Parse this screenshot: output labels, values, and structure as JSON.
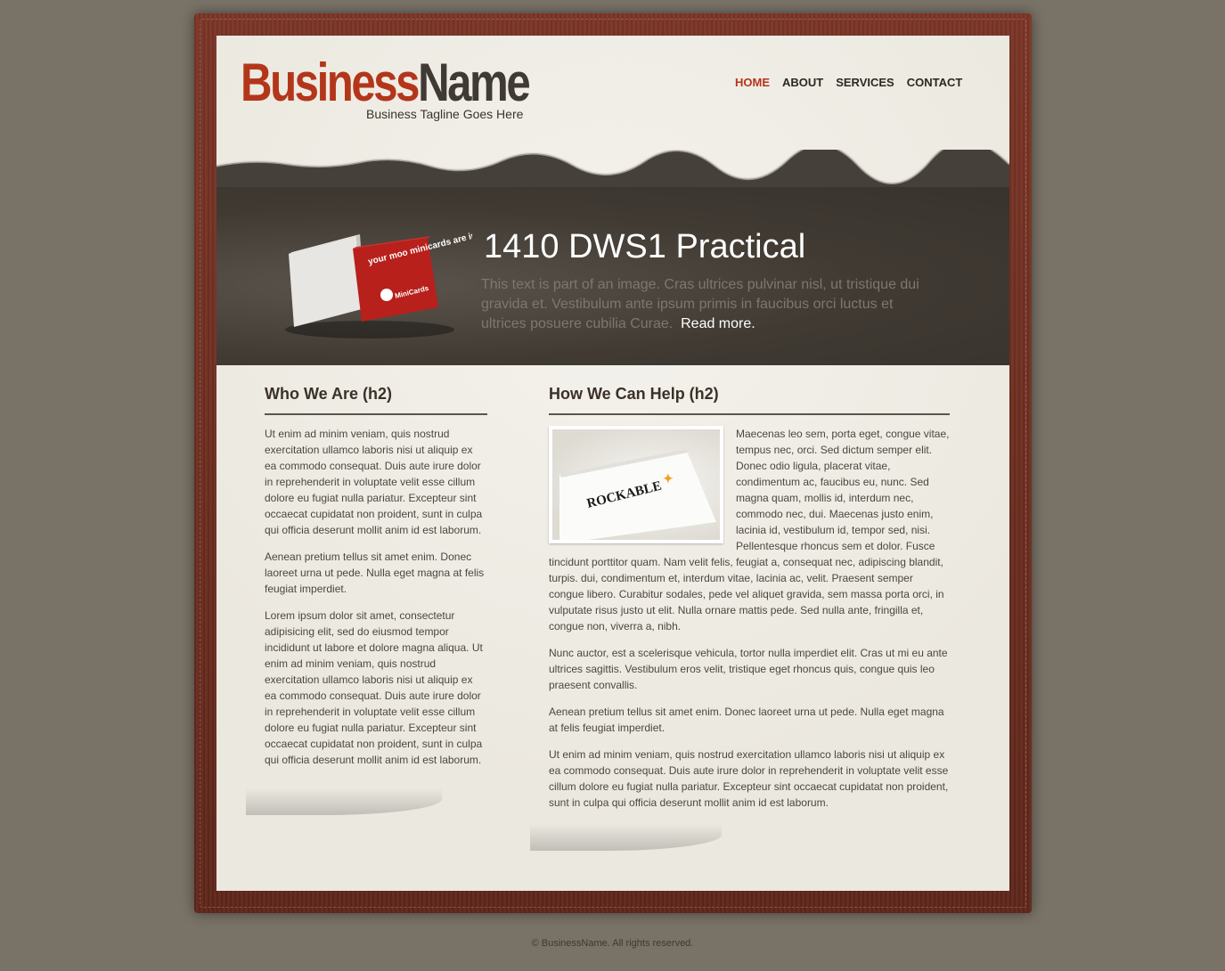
{
  "header": {
    "logo_part1": "Business",
    "logo_part2": "Name",
    "tagline": "Business Tagline Goes Here"
  },
  "nav": {
    "items": [
      "HOME",
      "ABOUT",
      "SERVICES",
      "CONTACT"
    ],
    "active": "HOME"
  },
  "hero": {
    "title": "1410 DWS1 Practical",
    "text": "This text is part of an image. Cras ultrices pulvinar nisl, ut tristique dui gravida et. Vestibulum ante ipsum primis in faucibus orci luctus et ultrices posuere cubilia Curae.",
    "read_more": "Read more.",
    "box_text": "your moo minicards are inside",
    "box_brand": "MiniCards"
  },
  "left_column": {
    "heading": "Who We Are (h2)",
    "paragraphs": [
      "Ut enim ad minim veniam, quis nostrud exercitation ullamco laboris nisi ut aliquip ex ea commodo consequat. Duis aute irure dolor in reprehenderit in voluptate velit esse cillum dolore eu fugiat nulla pariatur. Excepteur sint occaecat cupidatat non proident, sunt in culpa qui officia deserunt mollit anim id est laborum.",
      "Aenean pretium tellus sit amet enim. Donec laoreet urna ut pede. Nulla eget magna at felis feugiat imperdiet.",
      "Lorem ipsum dolor sit amet, consectetur adipisicing elit, sed do eiusmod tempor incididunt ut labore et dolore magna aliqua. Ut enim ad minim veniam, quis nostrud exercitation ullamco laboris nisi ut aliquip ex ea commodo consequat. Duis aute irure dolor in reprehenderit in voluptate velit esse cillum dolore eu fugiat nulla pariatur. Excepteur sint occaecat cupidatat non proident, sunt in culpa qui officia deserunt mollit anim id est laborum."
    ]
  },
  "right_column": {
    "heading": "How We Can Help (h2)",
    "image_logo": "ROCKABLE",
    "paragraphs": [
      "Maecenas leo sem, porta eget, congue vitae, tempus nec, orci. Sed dictum semper elit. Donec odio ligula, placerat vitae, condimentum ac, faucibus eu, nunc. Sed magna quam, mollis id, interdum nec, commodo nec, dui. Maecenas justo enim, lacinia id, vestibulum id, tempor sed, nisi. Pellentesque rhoncus sem et dolor. Fusce tincidunt porttitor quam. Nam velit felis, feugiat a, consequat nec, adipiscing blandit, turpis. dui, condimentum et, interdum vitae, lacinia ac, velit. Praesent semper congue libero. Curabitur sodales, pede vel aliquet gravida, sem massa porta orci, in vulputate risus justo ut elit. Nulla ornare mattis pede. Sed nulla ante, fringilla et, congue non, viverra a, nibh.",
      "Nunc auctor, est a scelerisque vehicula, tortor nulla imperdiet elit. Cras ut mi eu ante ultrices sagittis. Vestibulum eros velit, tristique eget rhoncus quis, congue quis leo praesent convallis.",
      "Aenean pretium tellus sit amet enim. Donec laoreet urna ut pede. Nulla eget magna at felis feugiat imperdiet.",
      "Ut enim ad minim veniam, quis nostrud exercitation ullamco laboris nisi ut aliquip ex ea commodo consequat. Duis aute irure dolor in reprehenderit in voluptate velit esse cillum dolore eu fugiat nulla pariatur. Excepteur sint occaecat cupidatat non proident, sunt in culpa qui officia deserunt mollit anim id est laborum."
    ]
  },
  "footer": {
    "copyright": "© BusinessName. All rights reserved."
  },
  "colors": {
    "brand_red": "#b3361b",
    "dark_brown": "#3f3a33",
    "frame_leather": "#6a2c1f",
    "background": "#797266",
    "paper": "#efede5"
  }
}
